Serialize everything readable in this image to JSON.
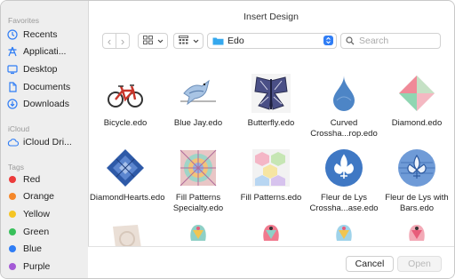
{
  "window": {
    "title": "Insert Design"
  },
  "sidebar": {
    "favorites_heading": "Favorites",
    "favorites": [
      {
        "label": "Recents",
        "icon": "clock-icon"
      },
      {
        "label": "Applicati...",
        "icon": "applications-icon"
      },
      {
        "label": "Desktop",
        "icon": "desktop-icon"
      },
      {
        "label": "Documents",
        "icon": "document-icon"
      },
      {
        "label": "Downloads",
        "icon": "download-icon"
      }
    ],
    "icloud_heading": "iCloud",
    "icloud": [
      {
        "label": "iCloud Dri...",
        "icon": "cloud-icon"
      }
    ],
    "tags_heading": "Tags",
    "tags": [
      {
        "label": "Red",
        "color": "#ec3b3b"
      },
      {
        "label": "Orange",
        "color": "#f5872a"
      },
      {
        "label": "Yellow",
        "color": "#f5c524"
      },
      {
        "label": "Green",
        "color": "#38c05a"
      },
      {
        "label": "Blue",
        "color": "#2f7df5"
      },
      {
        "label": "Purple",
        "color": "#a45ad6"
      }
    ]
  },
  "toolbar": {
    "back_glyph": "‹",
    "forward_glyph": "›",
    "location": "Edo",
    "search_placeholder": "Search"
  },
  "files": [
    {
      "name": "Bicycle.edo",
      "icon": "bicycle-thumbnail"
    },
    {
      "name": "Blue Jay.edo",
      "icon": "bluejay-thumbnail"
    },
    {
      "name": "Butterfly.edo",
      "icon": "butterfly-thumbnail"
    },
    {
      "name": "Curved Crossha...rop.edo",
      "icon": "curved-crosshatch-thumbnail"
    },
    {
      "name": "Diamond.edo",
      "icon": "diamond-thumbnail"
    },
    {
      "name": "DiamondHearts.edo",
      "icon": "diamondhearts-thumbnail"
    },
    {
      "name": "Fill Patterns Specialty.edo",
      "icon": "fillpatterns-specialty-thumbnail"
    },
    {
      "name": "Fill Patterns.edo",
      "icon": "fillpatterns-thumbnail"
    },
    {
      "name": "Fleur de Lys Crossha...ase.edo",
      "icon": "fleurdelys-crosshatch-thumbnail"
    },
    {
      "name": "Fleur de Lys with Bars.edo",
      "icon": "fleurdelys-bars-thumbnail"
    }
  ],
  "footer": {
    "cancel": "Cancel",
    "open": "Open"
  }
}
